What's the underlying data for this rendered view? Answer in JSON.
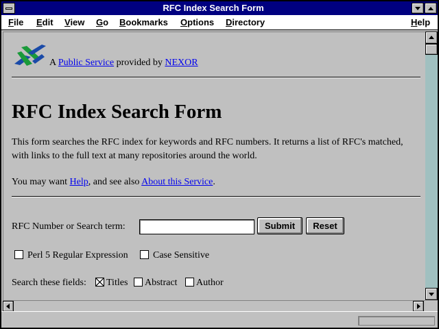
{
  "window": {
    "title": "RFC Index Search Form"
  },
  "menu": {
    "file": {
      "hot": "F",
      "rest": "ile"
    },
    "edit": {
      "hot": "E",
      "rest": "dit"
    },
    "view": {
      "hot": "V",
      "rest": "iew"
    },
    "go": {
      "hot": "G",
      "rest": "o"
    },
    "bookmarks": {
      "hot": "B",
      "rest": "ookmarks"
    },
    "options": {
      "hot": "O",
      "rest": "ptions"
    },
    "directory": {
      "hot": "D",
      "rest": "irectory"
    },
    "help": {
      "hot": "H",
      "rest": "elp"
    }
  },
  "header": {
    "prefix": "A ",
    "public_service_link": "Public Service",
    "provided_by": " provided by ",
    "nexor_link": "NEXOR"
  },
  "main": {
    "title": "RFC Index Search Form",
    "description": "This form searches the RFC index for keywords and RFC numbers. It returns a list of RFC's matched, with links to the full text at many repositories around the world.",
    "help_prefix": "You may want ",
    "help_link": "Help",
    "help_middle": ", and see also ",
    "about_link": "About this Service",
    "help_suffix": "."
  },
  "form": {
    "search_label": "RFC Number or Search term:",
    "search_value": "",
    "submit_label": "Submit",
    "reset_label": "Reset",
    "regex_label": "Perl 5 Regular Expression",
    "regex_checked": false,
    "case_label": "Case Sensitive",
    "case_checked": false,
    "fields_label": "Search these fields:",
    "titles_label": "Titles",
    "titles_checked": true,
    "abstract_label": "Abstract",
    "abstract_checked": false,
    "author_label": "Author",
    "author_checked": false
  },
  "status": {
    "text": ""
  },
  "colors": {
    "titlebar": "#000080",
    "background": "#c0c0c0",
    "link": "#0000ee",
    "scroll_track": "#a0c0c0",
    "logo_blue": "#1a4aa8",
    "logo_green": "#1a9a3a"
  },
  "icons": [
    "system-menu-icon",
    "minimize-icon",
    "maximize-icon",
    "nexor-logo-icon",
    "scroll-up-icon",
    "scroll-down-icon",
    "scroll-left-icon",
    "scroll-right-icon"
  ]
}
